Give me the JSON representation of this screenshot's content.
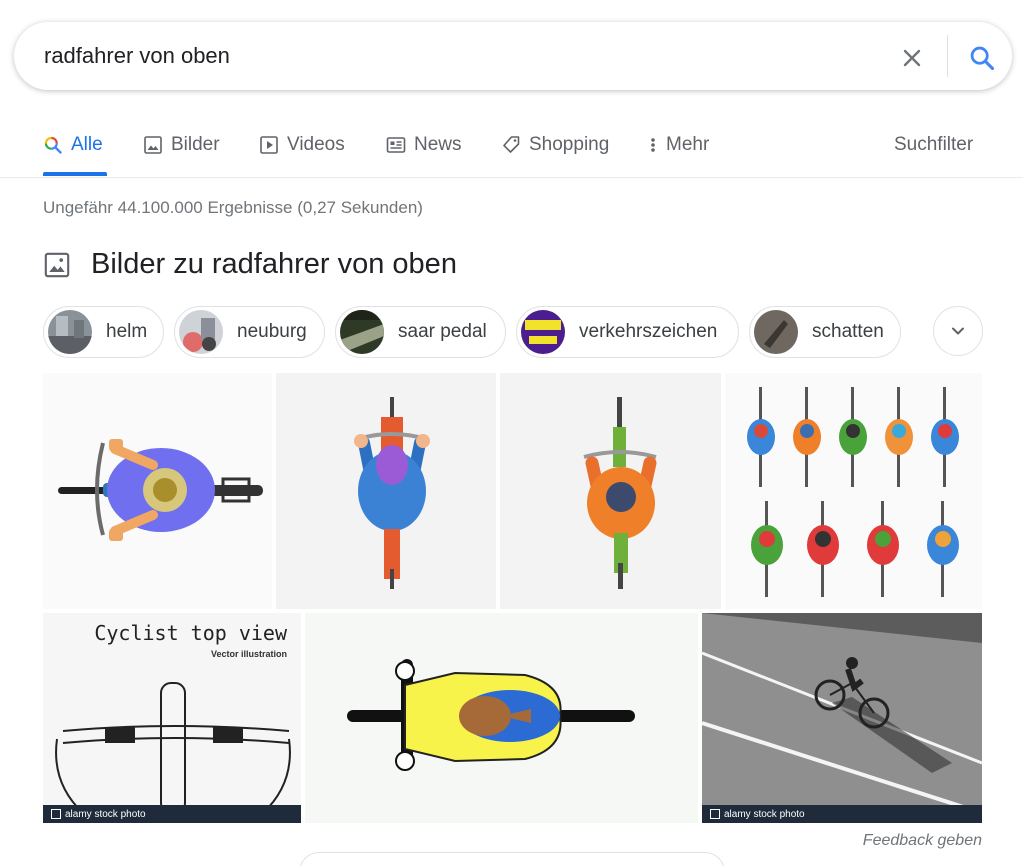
{
  "search": {
    "query": "radfahrer von oben"
  },
  "tabs": [
    {
      "label": "Alle",
      "icon": "search-multicolor-icon",
      "active": true
    },
    {
      "label": "Bilder",
      "icon": "image-icon"
    },
    {
      "label": "Videos",
      "icon": "play-icon"
    },
    {
      "label": "News",
      "icon": "newspaper-icon"
    },
    {
      "label": "Shopping",
      "icon": "tag-icon"
    },
    {
      "label": "Mehr",
      "icon": "more-vert-icon"
    }
  ],
  "tools_label": "Suchfilter",
  "result_stats": "Ungefähr 44.100.000 Ergebnisse (0,27 Sekunden)",
  "images_section": {
    "title": "Bilder zu radfahrer von oben",
    "chips": [
      {
        "label": "helm"
      },
      {
        "label": "neuburg"
      },
      {
        "label": "saar pedal"
      },
      {
        "label": "verkehrszeichen"
      },
      {
        "label": "schatten"
      }
    ],
    "images": [
      {
        "caption": ""
      },
      {
        "caption": ""
      },
      {
        "caption": ""
      },
      {
        "caption": ""
      },
      {
        "caption": "Cyclist top view",
        "subcaption": "Vector illustration",
        "watermark": "alamy stock photo"
      },
      {
        "caption": ""
      },
      {
        "caption": "",
        "watermark": "alamy stock photo"
      }
    ]
  },
  "feedback_label": "Feedback geben",
  "colors": {
    "accent": "#1a73e8",
    "text_muted": "#70757a",
    "border": "#dfe1e5"
  }
}
